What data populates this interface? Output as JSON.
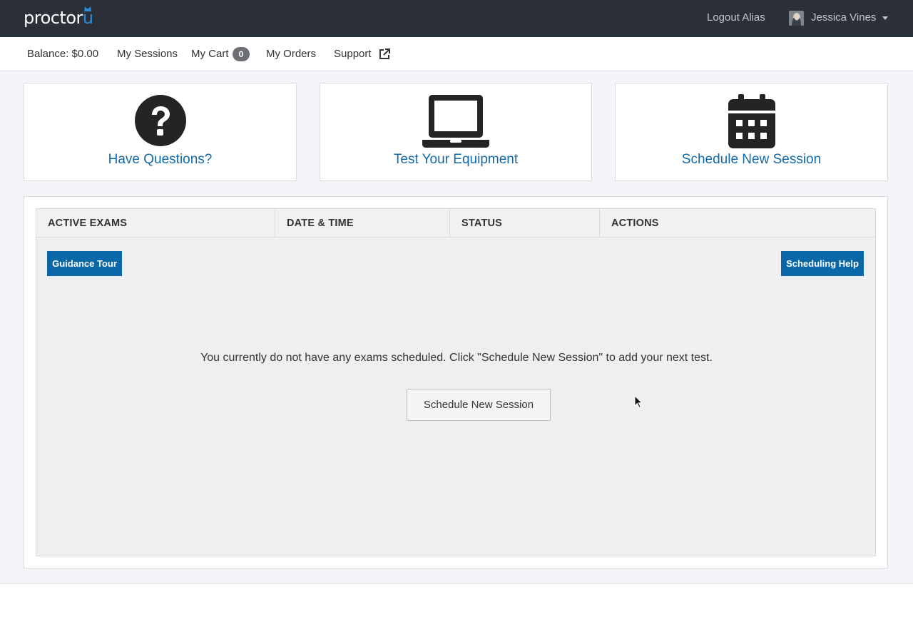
{
  "header": {
    "logo_main": "proctor",
    "logo_accent": "u",
    "logout_alias": "Logout Alias",
    "user_name": "Jessica Vines"
  },
  "subnav": {
    "balance": "Balance: $0.00",
    "my_sessions": "My Sessions",
    "my_cart": "My Cart",
    "cart_count": "0",
    "my_orders": "My Orders",
    "support": "Support"
  },
  "cards": [
    {
      "label": "Have Questions?",
      "icon": "question-circle-icon"
    },
    {
      "label": "Test Your Equipment",
      "icon": "laptop-icon"
    },
    {
      "label": "Schedule New Session",
      "icon": "calendar-icon"
    }
  ],
  "table": {
    "columns": [
      "ACTIVE EXAMS",
      "DATE & TIME",
      "STATUS",
      "ACTIONS"
    ],
    "guidance_tour": "Guidance Tour",
    "scheduling_help": "Scheduling Help",
    "empty_message": "You currently do not have any exams scheduled. Click \"Schedule New Session\" to add your next test.",
    "schedule_button": "Schedule New Session"
  },
  "colors": {
    "topbar": "#2b2f38",
    "link_blue": "#136aaa",
    "button_blue": "#0a67a8",
    "logo_accent": "#2a8ad6"
  }
}
